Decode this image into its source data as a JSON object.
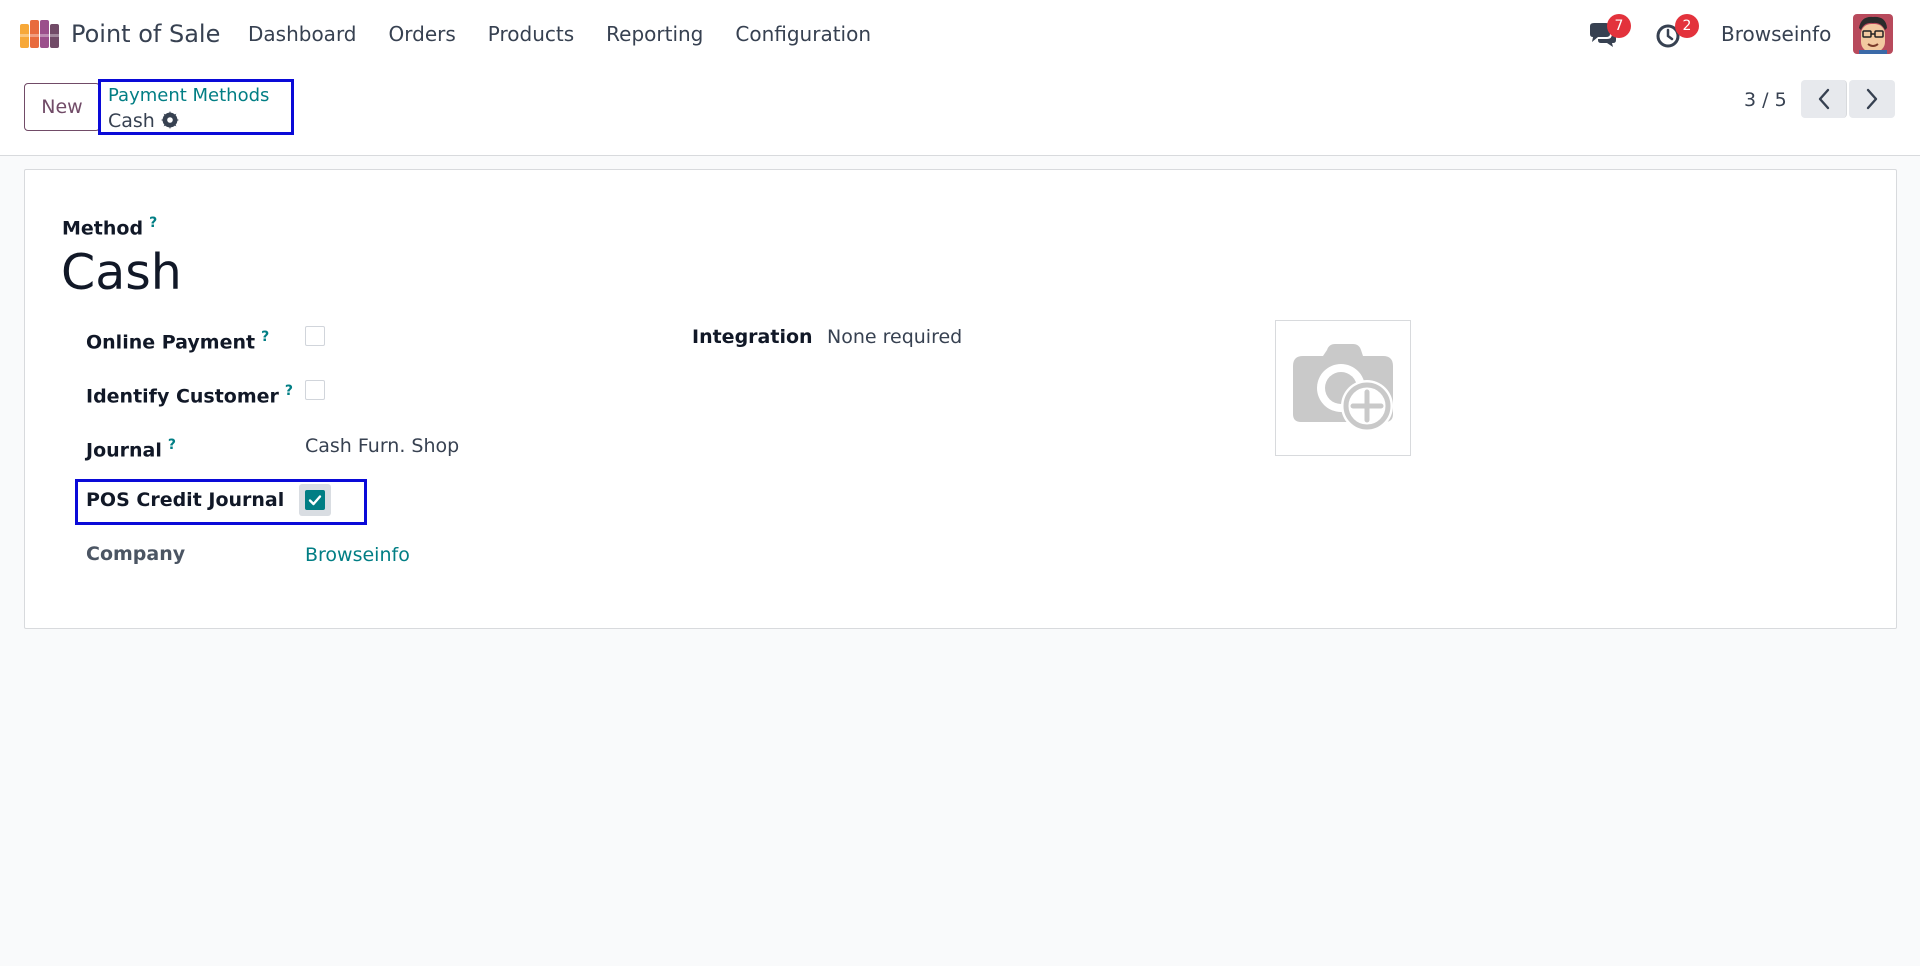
{
  "navbar": {
    "app_name": "Point of Sale",
    "menu": [
      {
        "label": "Dashboard"
      },
      {
        "label": "Orders"
      },
      {
        "label": "Products"
      },
      {
        "label": "Reporting"
      },
      {
        "label": "Configuration"
      }
    ],
    "messages_count": "7",
    "activities_count": "2",
    "user_name": "Browseinfo"
  },
  "control_panel": {
    "new_label": "New",
    "breadcrumb_parent": "Payment Methods",
    "breadcrumb_current": "Cash",
    "pager": "3 / 5"
  },
  "form": {
    "method_label": "Method",
    "help_mark": "?",
    "record_name": "Cash",
    "fields": {
      "online_payment": {
        "label": "Online Payment",
        "checked": false
      },
      "identify_customer": {
        "label": "Identify Customer",
        "checked": false
      },
      "journal": {
        "label": "Journal",
        "value": "Cash Furn. Shop"
      },
      "pos_credit_journal": {
        "label": "POS Credit Journal",
        "checked": true
      },
      "company": {
        "label": "Company",
        "value": "Browseinfo"
      },
      "integration": {
        "label": "Integration",
        "value": "None required"
      }
    }
  },
  "colors": {
    "accent": "#017e84",
    "brand": "#714b67",
    "badge": "#e3323c",
    "highlight": "#0a0ad8"
  }
}
